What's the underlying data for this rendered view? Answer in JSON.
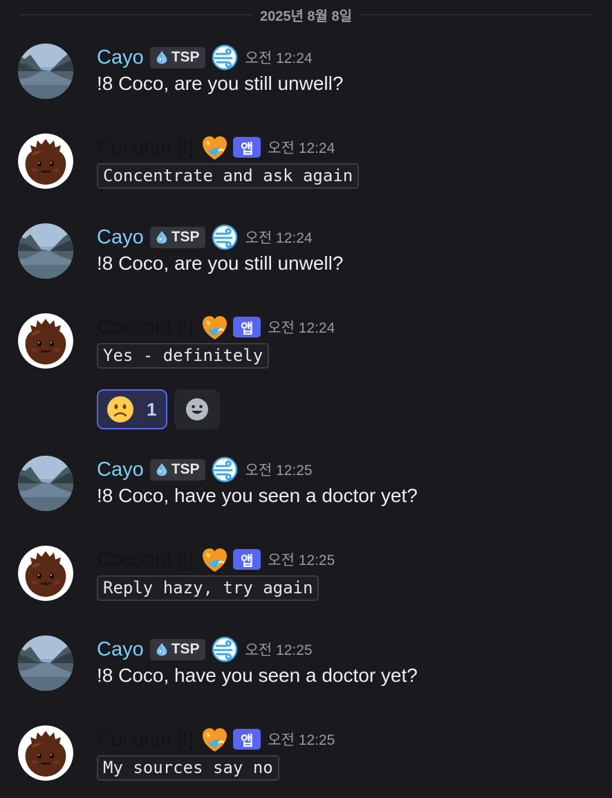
{
  "date_divider": "2025년 8월 8일",
  "colors": {
    "background": "#1a1a1e",
    "cayo_name": "#7fcff9",
    "coconut_name": "#111214",
    "app_badge": "#5865f2",
    "timestamp": "#949ba4"
  },
  "messages": [
    {
      "author": "Cayo",
      "tag": "TSP",
      "role_icon": "wind-swirl-icon",
      "time": "오전 12:24",
      "text": "!8 Coco, are you still unwell?"
    },
    {
      "author": "Coconut [!]",
      "badge": "앱",
      "role_icon": "heart-icon",
      "time": "오전 12:24",
      "code": "Concentrate and ask again"
    },
    {
      "author": "Cayo",
      "tag": "TSP",
      "role_icon": "wind-swirl-icon",
      "time": "오전 12:24",
      "text": "!8 Coco, are you still unwell?"
    },
    {
      "author": "Coconut [!]",
      "badge": "앱",
      "role_icon": "heart-icon",
      "time": "오전 12:24",
      "code": "Yes - definitely",
      "reactions": [
        {
          "emoji": "slightly-frowning-face",
          "count": "1"
        }
      ],
      "add_reaction_icon": "smiley-add-reaction-icon"
    },
    {
      "author": "Cayo",
      "tag": "TSP",
      "role_icon": "wind-swirl-icon",
      "time": "오전 12:25",
      "text": "!8 Coco, have you seen a doctor yet?"
    },
    {
      "author": "Coconut [!]",
      "badge": "앱",
      "role_icon": "heart-icon",
      "time": "오전 12:25",
      "code": "Reply hazy, try again"
    },
    {
      "author": "Cayo",
      "tag": "TSP",
      "role_icon": "wind-swirl-icon",
      "time": "오전 12:25",
      "text": "!8 Coco, have you seen a doctor yet?"
    },
    {
      "author": "Coconut [!]",
      "badge": "앱",
      "role_icon": "heart-icon",
      "time": "오전 12:25",
      "code": "My sources say no"
    }
  ]
}
